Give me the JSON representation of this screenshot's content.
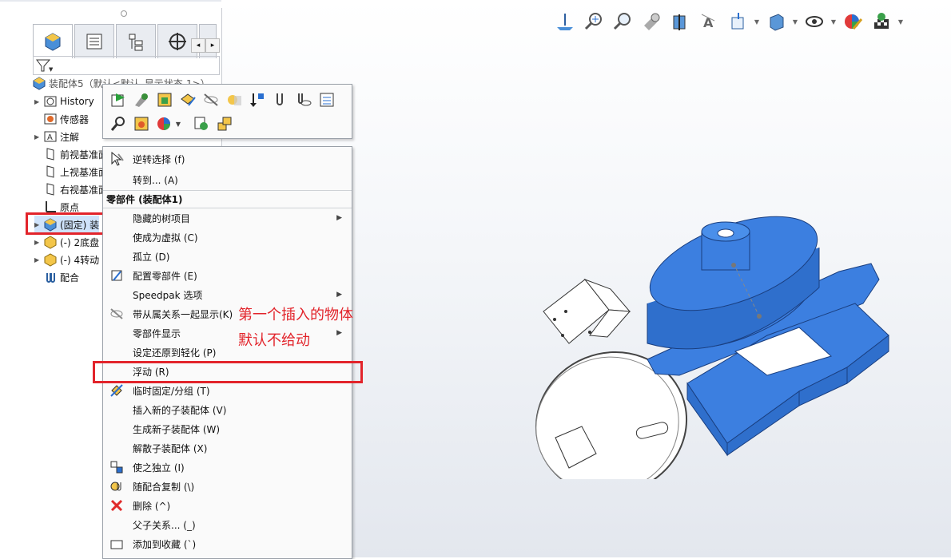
{
  "feature_tree": {
    "root": "装配体5（默认<默认_显示状态-1>）",
    "items": [
      {
        "label": "History",
        "expandable": true
      },
      {
        "label": "传感器",
        "expandable": false
      },
      {
        "label": "注解",
        "expandable": true
      },
      {
        "label": "前视基准面",
        "expandable": false
      },
      {
        "label": "上视基准面",
        "expandable": false
      },
      {
        "label": "右视基准面",
        "expandable": false
      },
      {
        "label": "原点",
        "expandable": false
      },
      {
        "label": "(固定) 装",
        "expandable": true
      },
      {
        "label": "(-) 2底盘",
        "expandable": true
      },
      {
        "label": "(-) 4转动",
        "expandable": true
      },
      {
        "label": "配合",
        "expandable": false
      }
    ]
  },
  "context_menu": {
    "top_items": [
      {
        "label": "逆转选择 (f)"
      },
      {
        "label": "转到... (A)"
      }
    ],
    "section_header": "零部件 (装配体1)",
    "items": [
      {
        "label": "隐藏的树项目",
        "submenu": true
      },
      {
        "label": "使成为虚拟 (C)"
      },
      {
        "label": "孤立 (D)"
      },
      {
        "label": "配置零部件 (E)"
      },
      {
        "label": "Speedpak 选项",
        "submenu": true
      },
      {
        "label": "带从属关系一起显示(K)"
      },
      {
        "label": "零部件显示",
        "submenu": true
      },
      {
        "label": "设定还原到轻化 (P)"
      },
      {
        "label": "浮动 (R)"
      },
      {
        "label": "临时固定/分组 (T)"
      },
      {
        "label": "插入新的子装配体 (V)"
      },
      {
        "label": "生成新子装配体 (W)"
      },
      {
        "label": "解散子装配体 (X)"
      },
      {
        "label": "使之独立 (I)"
      },
      {
        "label": "随配合复制 (\\)"
      },
      {
        "label": "删除 (^)"
      },
      {
        "label": "父子关系... (_)"
      },
      {
        "label": "添加到收藏 (`)"
      }
    ]
  },
  "annotation": {
    "line1": "第一个插入的物体",
    "line2": "默认不给动",
    "color": "#e2242b"
  },
  "colors": {
    "part_blue": "#3c7fe0",
    "part_dark": "#1f4fa0",
    "menu_bg": "#fafafa"
  }
}
